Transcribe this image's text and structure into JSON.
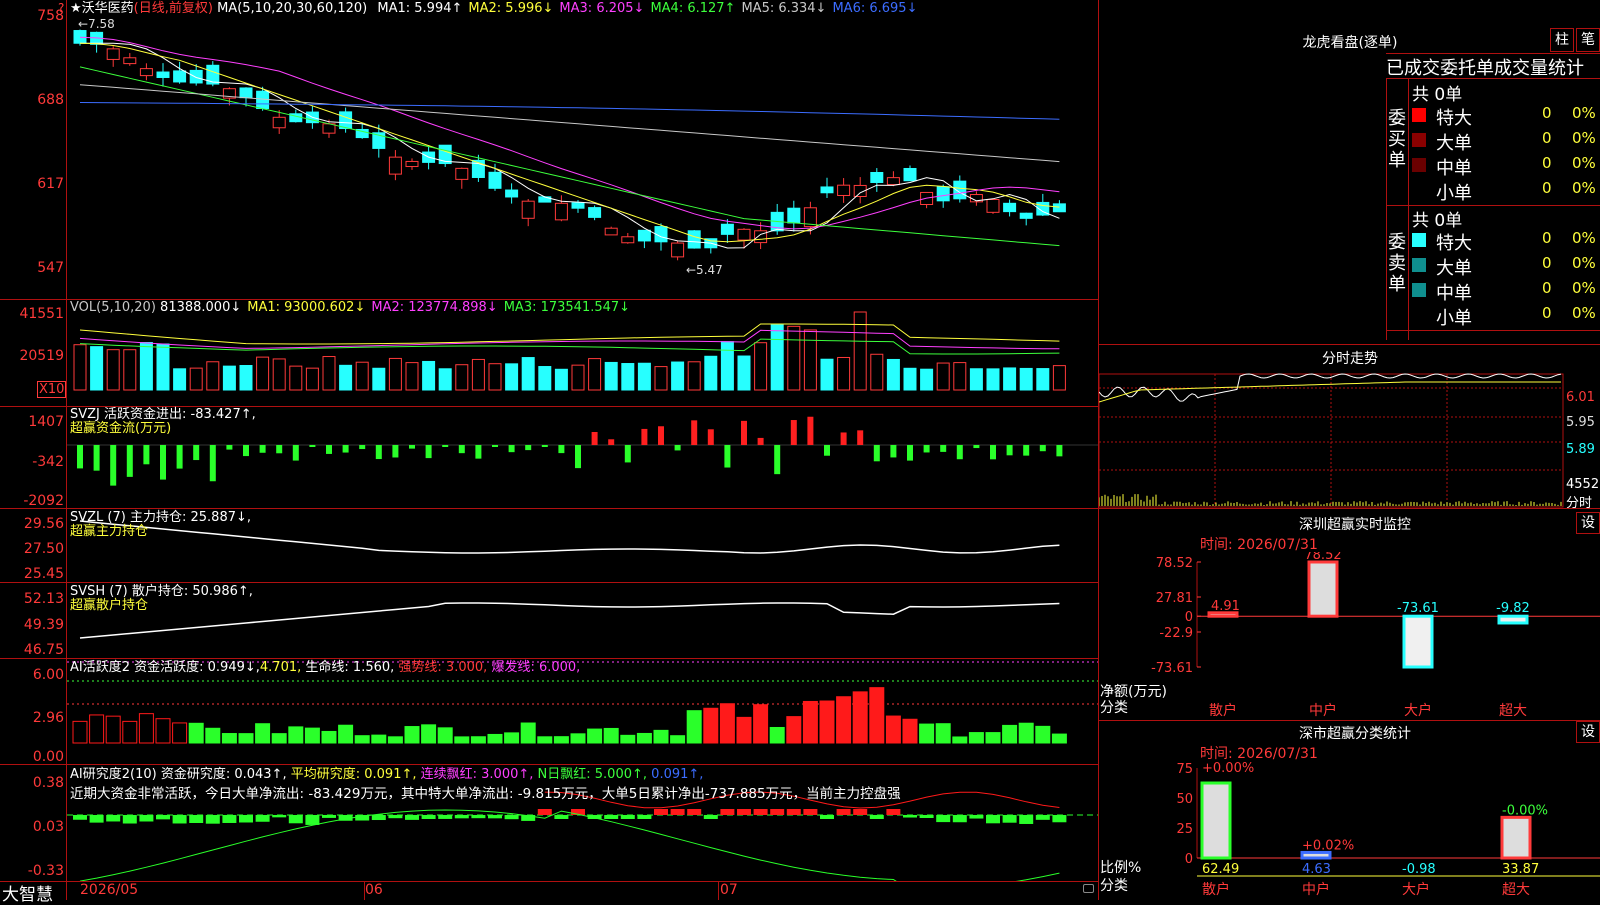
{
  "main": {
    "title": "★沃华医药",
    "mode": "(日线,前复权)",
    "ma_label": "MA(5,10,20,30,60,120)",
    "ma": [
      {
        "label": "MA1:",
        "value": "5.994",
        "arrow": "↑",
        "color": "#ffffff"
      },
      {
        "label": "MA2:",
        "value": "5.996",
        "arrow": "↓",
        "color": "#ffff3c"
      },
      {
        "label": "MA3:",
        "value": "6.205",
        "arrow": "↓",
        "color": "#ff40ff"
      },
      {
        "label": "MA4:",
        "value": "6.127",
        "arrow": "↑",
        "color": "#3cff3c"
      },
      {
        "label": "MA5:",
        "value": "6.334",
        "arrow": "↓",
        "color": "#c8c8c8"
      },
      {
        "label": "MA6:",
        "value": "6.695",
        "arrow": "↓",
        "color": "#3c6dff"
      }
    ],
    "y_ticks": [
      "758",
      "688",
      "617",
      "547"
    ],
    "high_marker": "←7.58",
    "low_marker": "←5.47",
    "question_mark": "?"
  },
  "vol": {
    "label": "VOL(5,10,20)",
    "value": "81388.000↓",
    "ma": [
      {
        "label": "MA1:",
        "value": "93000.602↓",
        "color": "#ffff3c"
      },
      {
        "label": "MA2:",
        "value": "123774.898↓",
        "color": "#ff40ff"
      },
      {
        "label": "MA3:",
        "value": "173541.547↓",
        "color": "#3cff3c"
      }
    ],
    "y_ticks": [
      "41551",
      "20519"
    ],
    "unit": "X10"
  },
  "svzj": {
    "label": "SVZJ  活跃资金进出:",
    "value": "-83.427↑,",
    "sub": "超赢资金流(万元)",
    "y_ticks": [
      "1407",
      "-342",
      "-2092"
    ]
  },
  "svzl": {
    "label": "SVZL (7) 主力持仓:",
    "value": "25.887↓,",
    "sub": "超赢主力持仓",
    "y_ticks": [
      "29.56",
      "27.50",
      "25.45"
    ]
  },
  "svsh": {
    "label": "SVSH (7) 散户持仓:",
    "value": "50.986↑,",
    "sub": "超赢散户持仓",
    "y_ticks": [
      "52.13",
      "49.39",
      "46.75"
    ]
  },
  "ai1": {
    "label": "AI活跃度2 资金活跃度:",
    "value1": "0.949↓,",
    "value2": "4.701,",
    "life": "生命线: 1.560,",
    "strong": "强势线: 3.000,",
    "burst": "爆发线: 6.000,",
    "y_ticks": [
      "6.00",
      "2.96",
      "0.00"
    ]
  },
  "ai2": {
    "label": "AI研究度2(10) 资金研究度:",
    "value": "0.043↑,",
    "avg": "平均研究度: 0.091↑,",
    "red": "连续飘红: 3.000↑,",
    "nred": "N日飘红: 5.000↑,",
    "blue": "0.091↑,",
    "comment": "近期大资金非常活跃，今日大单净流出: -83.429万元，其中特大单净流出: -9.815万元，大单5日累计净出-737.885万元，当前主力控盘强",
    "y_ticks": [
      "0.38",
      "0.03",
      "-0.33"
    ]
  },
  "x_axis": {
    "brand": "大智慧",
    "labels": [
      "2026/05",
      "06",
      "07"
    ]
  },
  "dragon": {
    "title": "龙虎看盘(逐单)",
    "btn_bar": "柱",
    "btn_pen": "笔",
    "subtitle": "已成交委托单成交量统计",
    "buy_label": "委买单",
    "sell_label": "委卖单",
    "buy_total": "共 0单",
    "sell_total": "共 0单",
    "buy_rows": [
      {
        "name": "特大",
        "count": "0",
        "pct": "0%",
        "color": "#ff0000"
      },
      {
        "name": "大单",
        "count": "0",
        "pct": "0%",
        "color": "#8a0000"
      },
      {
        "name": "中单",
        "count": "0",
        "pct": "0%",
        "color": "#6a0000"
      },
      {
        "name": "小单",
        "count": "0",
        "pct": "0%",
        "color": ""
      }
    ],
    "sell_rows": [
      {
        "name": "特大",
        "count": "0",
        "pct": "0%",
        "color": "#27ffff"
      },
      {
        "name": "大单",
        "count": "0",
        "pct": "0%",
        "color": "#0f8f8f"
      },
      {
        "name": "中单",
        "count": "0",
        "pct": "0%",
        "color": "#0f8f8f"
      },
      {
        "name": "小单",
        "count": "0",
        "pct": "0%",
        "color": ""
      }
    ]
  },
  "intraday": {
    "title": "分时走势",
    "prices": [
      "6.01",
      "5.95",
      "5.89"
    ],
    "vol": "4552",
    "unit": "分时"
  },
  "monitor": {
    "title": "深圳超赢实时监控",
    "btn": "设",
    "time": "时间: 2026/07/31",
    "y_ticks": [
      "78.52",
      "27.81",
      "0",
      "-22.9",
      "-73.61"
    ],
    "ylabel": "净额(万元)",
    "xlabel": "分类",
    "bars": [
      {
        "name": "散户",
        "value": 4.91,
        "label": "4.91",
        "color": "#ff3a3a"
      },
      {
        "name": "中户",
        "value": 78.52,
        "label": "78.52",
        "color": "#ff3a3a"
      },
      {
        "name": "大户",
        "value": -73.61,
        "label": "-73.61",
        "color": "#27ffff"
      },
      {
        "name": "超大",
        "value": -9.82,
        "label": "-9.82",
        "color": "#27ffff"
      }
    ]
  },
  "stats": {
    "title": "深市超赢分类统计",
    "btn": "设",
    "time": "时间: 2026/07/31",
    "y_ticks": [
      "75",
      "50",
      "25",
      "0"
    ],
    "ylabel": "比例%",
    "xlabel": "分类",
    "bars": [
      {
        "name": "散户",
        "top": "+0.00%",
        "bottom": "62.49",
        "value": 62.49,
        "color": "#ffff3c"
      },
      {
        "name": "中户",
        "top": "+0.02%",
        "bottom": "4.63",
        "value": 4.63,
        "color": "#3c6dff"
      },
      {
        "name": "大户",
        "top": "",
        "bottom": "-0.98",
        "value": 0,
        "color": "#27ffff"
      },
      {
        "name": "超大",
        "top": "-0.00%",
        "bottom": "33.87",
        "value": 33.87,
        "color": "#ffff3c"
      }
    ]
  }
}
